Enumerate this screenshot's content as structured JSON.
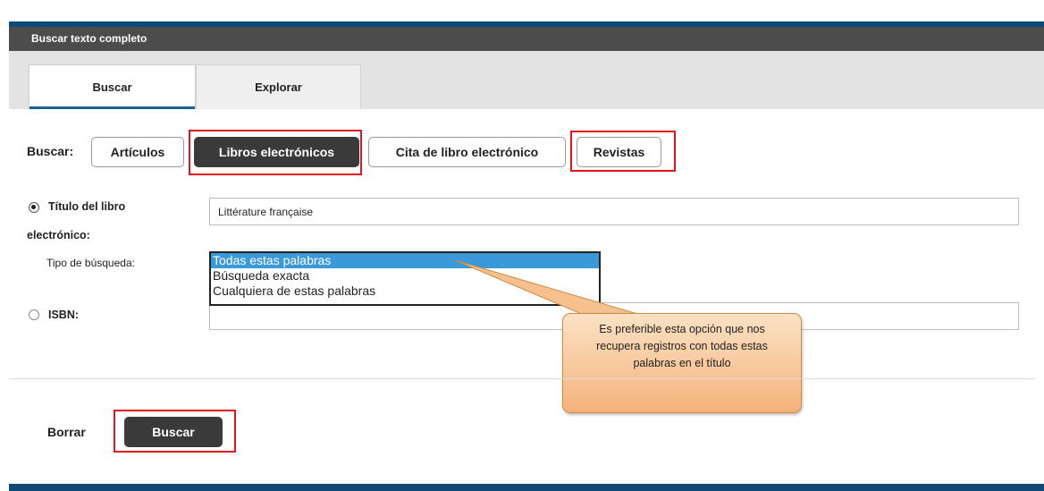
{
  "panel": {
    "title": "Buscar texto completo"
  },
  "tabs": [
    {
      "label": "Buscar",
      "active": true
    },
    {
      "label": "Explorar",
      "active": false
    }
  ],
  "search_type": {
    "label": "Buscar:",
    "options": [
      {
        "label": "Artículos",
        "selected": false
      },
      {
        "label": "Libros electrónicos",
        "selected": true
      },
      {
        "label": "Cita de libro electrónico",
        "selected": false
      },
      {
        "label": "Revistas",
        "selected": false
      }
    ]
  },
  "title_field": {
    "label_line1": "Título del libro",
    "label_line2": "electrónico:",
    "value": "Littérature française",
    "checked": true
  },
  "search_mode": {
    "label": "Tipo de búsqueda:",
    "options": [
      "Todas estas palabras",
      "Búsqueda exacta",
      "Cualquiera de estas palabras"
    ],
    "selected": "Todas estas palabras"
  },
  "isbn_field": {
    "label": "ISBN:",
    "value": "",
    "checked": false
  },
  "actions": {
    "clear_label": "Borrar",
    "search_label": "Buscar"
  },
  "callout": {
    "text": "Es preferible esta opción que nos recupera registros con todas estas palabras en el título"
  },
  "colors": {
    "header_bg": "#4c4c4c",
    "accent_blue": "#0e4a78",
    "selected_button": "#3a3a3a",
    "highlight_red": "#e3141b",
    "listbox_selected": "#3a9ad9"
  }
}
